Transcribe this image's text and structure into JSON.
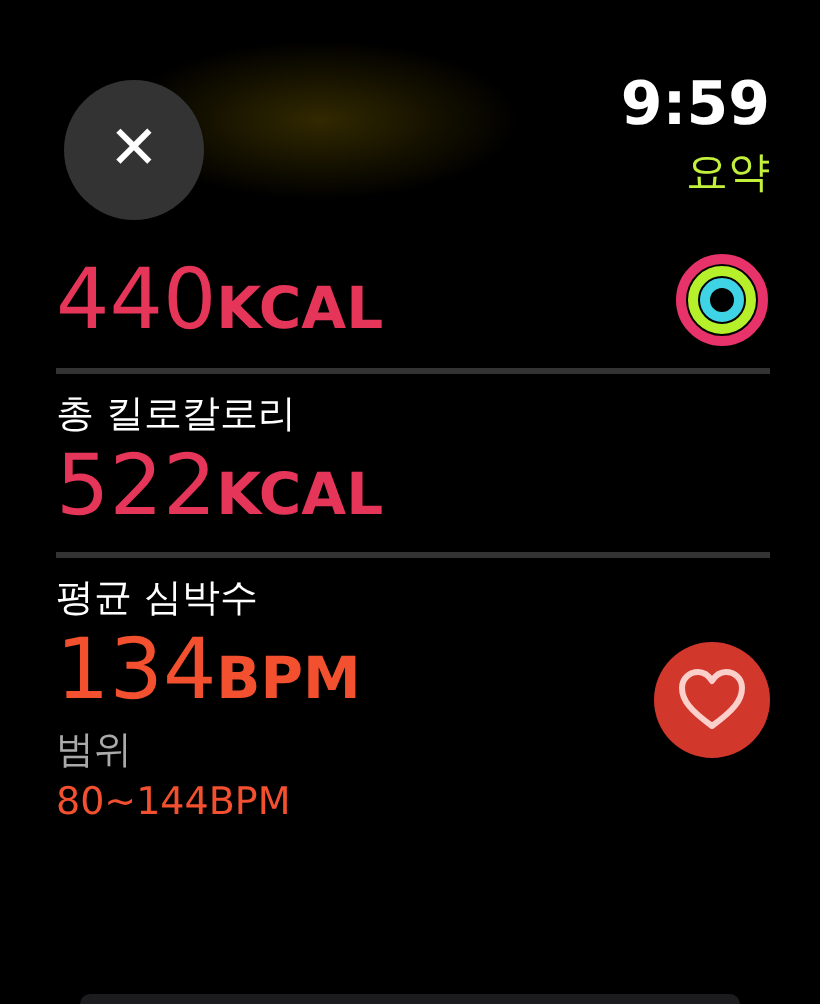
{
  "header": {
    "close": "✕",
    "time": "9:59",
    "title": "요약"
  },
  "metrics": [
    {
      "value": "440",
      "unit": "KCAL",
      "color": "#e5365a",
      "kind": "rings"
    },
    {
      "label": "총 킬로칼로리",
      "value": "522",
      "unit": "KCAL",
      "color": "#e5365a"
    },
    {
      "label": "평균 심박수",
      "value": "134",
      "unit": "BPM",
      "color": "#f2502e",
      "kind": "heart",
      "range_label": "범위",
      "range": "80~144BPM"
    }
  ]
}
